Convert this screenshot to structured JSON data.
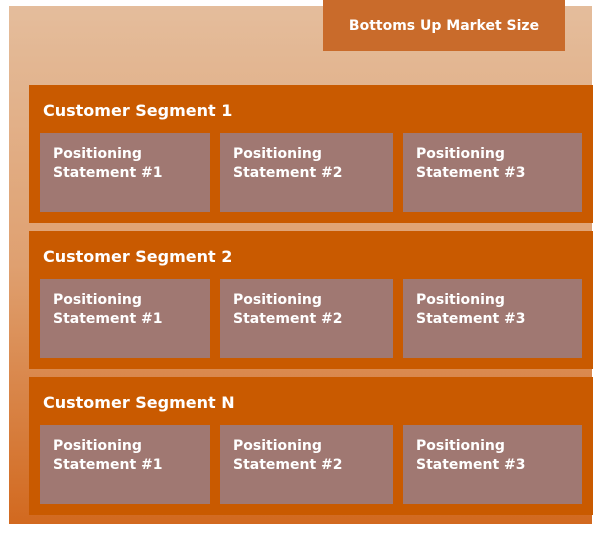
{
  "header": {
    "title": "Bottoms Up Market Size"
  },
  "segments": [
    {
      "title": "Customer Segment 1",
      "statements": [
        {
          "line1": "Positioning",
          "line2": "Statement #1"
        },
        {
          "line1": "Positioning",
          "line2": "Statement #2"
        },
        {
          "line1": "Positioning",
          "line2": "Statement #3"
        }
      ]
    },
    {
      "title": "Customer Segment 2",
      "statements": [
        {
          "line1": "Positioning",
          "line2": "Statement #1"
        },
        {
          "line1": "Positioning",
          "line2": "Statement #2"
        },
        {
          "line1": "Positioning",
          "line2": "Statement #3"
        }
      ]
    },
    {
      "title": "Customer Segment N",
      "statements": [
        {
          "line1": "Positioning",
          "line2": "Statement #1"
        },
        {
          "line1": "Positioning",
          "line2": "Statement #2"
        },
        {
          "line1": "Positioning",
          "line2": "Statement #3"
        }
      ]
    }
  ],
  "colors": {
    "tab": "#c96b2b",
    "segment": "#c95a00",
    "card": "#a07872"
  }
}
